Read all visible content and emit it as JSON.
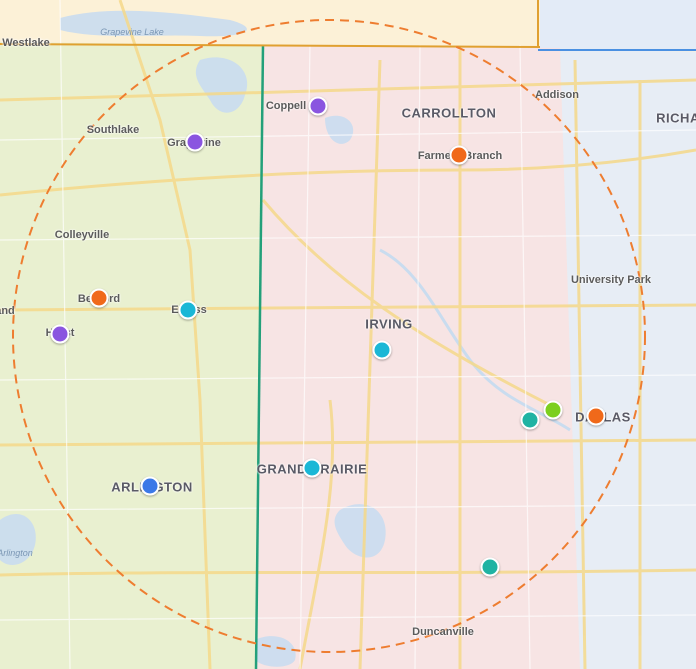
{
  "map": {
    "labels": {
      "westlake": "Westlake",
      "grapevine_lake": "Grapevine Lake",
      "southlake": "Southlake",
      "grapevine": "Grapevine",
      "colleyville": "Colleyville",
      "bedford": "Bedford",
      "hurst": "Hurst",
      "euless": "Euless",
      "arlington": "ARLINGTON",
      "arlington_small": "Arlington",
      "coppell": "Coppell",
      "carrollton": "CARROLLTON",
      "addison": "Addison",
      "richardson": "RICHA",
      "farmers_branch": "Farmers Branch",
      "irving": "IRVING",
      "university_park": "University Park",
      "dallas": "DALLAS",
      "grand_prairie": "GRAND PRAIRIE",
      "duncanville": "Duncanville",
      "land_left": "and"
    },
    "colors": {
      "radius_circle": "#ee7d30",
      "county_line_green": "#23a07a",
      "county_line_orange": "#e0a030",
      "county_line_blue": "#4a90e2",
      "region_green": "#e6f1cf",
      "region_pink": "#f8e3e6",
      "region_blue": "#e7edf7",
      "region_yellow": "#fdf3d9"
    },
    "markers": [
      {
        "name": "marker-grapevine",
        "color": "#8a55e0"
      },
      {
        "name": "marker-coppell",
        "color": "#8a55e0"
      },
      {
        "name": "marker-farmers-branch",
        "color": "#f0691a"
      },
      {
        "name": "marker-bedford",
        "color": "#f0691a"
      },
      {
        "name": "marker-euless",
        "color": "#1ab7d6"
      },
      {
        "name": "marker-hurst",
        "color": "#8a55e0"
      },
      {
        "name": "marker-irving",
        "color": "#1ab7d6"
      },
      {
        "name": "marker-dallas-teal",
        "color": "#1fb3a3"
      },
      {
        "name": "marker-dallas-green",
        "color": "#7ccf1f"
      },
      {
        "name": "marker-dallas",
        "color": "#f0691a"
      },
      {
        "name": "marker-grand-prairie",
        "color": "#1ab7d6"
      },
      {
        "name": "marker-arlington",
        "color": "#3b78e7"
      },
      {
        "name": "marker-south-dallas",
        "color": "#1fb3a3"
      }
    ]
  }
}
